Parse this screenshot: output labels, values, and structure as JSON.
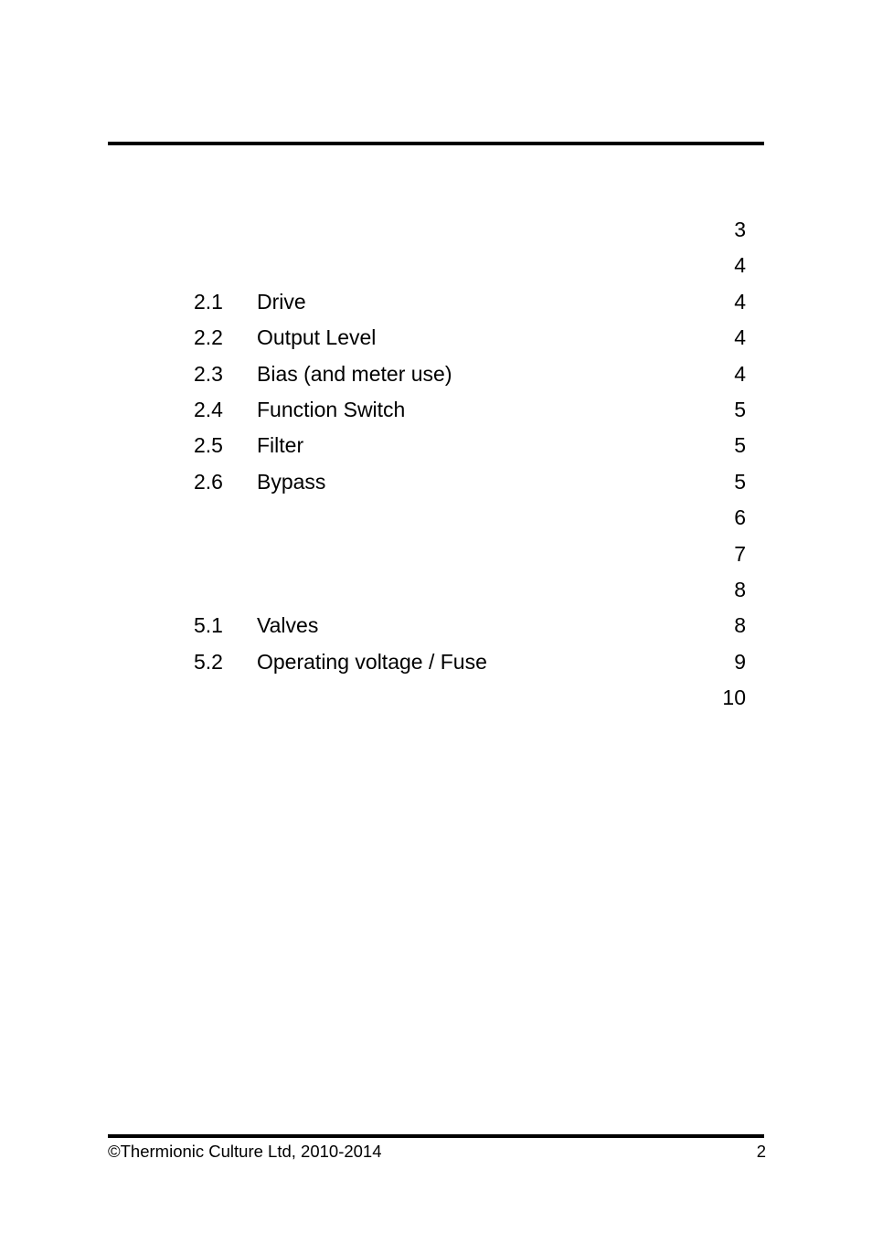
{
  "document": {
    "page_number": "2",
    "copyright": "©Thermionic Culture Ltd, 2010-2014"
  },
  "toc": {
    "entries": [
      {
        "number": "",
        "label": "",
        "page": "3",
        "level": 1
      },
      {
        "number": "",
        "label": "",
        "page": "4",
        "level": 1
      },
      {
        "number": "2.1",
        "label": "Drive",
        "page": "4",
        "level": 2
      },
      {
        "number": "2.2",
        "label": "Output Level",
        "page": "4",
        "level": 2
      },
      {
        "number": "2.3",
        "label": "Bias (and meter use)",
        "page": "4",
        "level": 2
      },
      {
        "number": "2.4",
        "label": "Function Switch",
        "page": "5",
        "level": 2
      },
      {
        "number": "2.5",
        "label": "Filter",
        "page": "5",
        "level": 2
      },
      {
        "number": "2.6",
        "label": "Bypass",
        "page": "5",
        "level": 2
      },
      {
        "number": "",
        "label": "",
        "page": "6",
        "level": 1
      },
      {
        "number": "",
        "label": "",
        "page": "7",
        "level": 1
      },
      {
        "number": "",
        "label": "",
        "page": "8",
        "level": 1
      },
      {
        "number": "5.1",
        "label": "Valves",
        "page": "8",
        "level": 2
      },
      {
        "number": "5.2",
        "label": "Operating voltage / Fuse",
        "page": "9",
        "level": 2
      },
      {
        "number": "",
        "label": "",
        "page": "10",
        "level": 1
      }
    ]
  }
}
